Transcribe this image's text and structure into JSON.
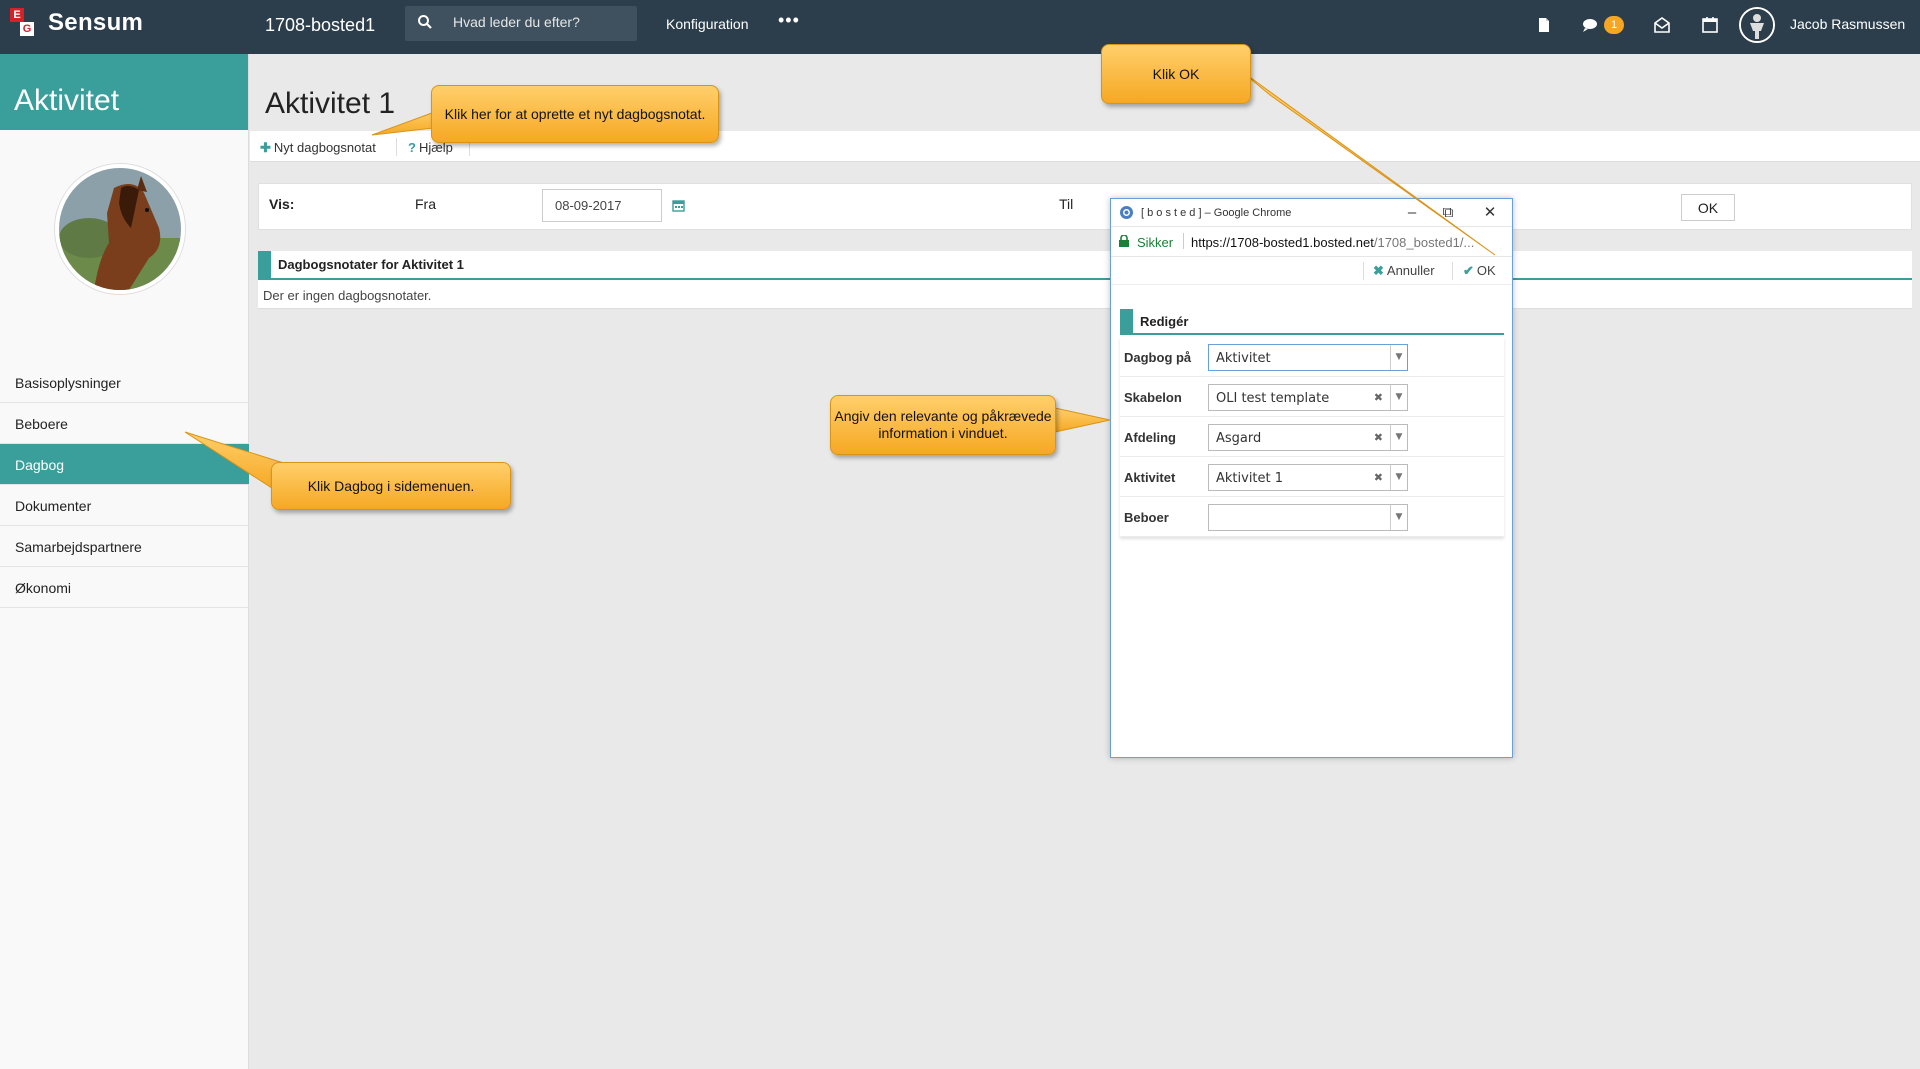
{
  "topbar": {
    "logo_text": "Sensum",
    "logo_letters": [
      "E",
      "G"
    ],
    "org_name": "1708-bosted1",
    "search_placeholder": "Hvad leder du efter?",
    "nav_config": "Konfiguration",
    "nav_more": "•••",
    "notification_count": "1",
    "user_name": "Jacob Rasmussen",
    "icons": [
      "search-icon",
      "document-icon",
      "chat-icon",
      "mail-icon",
      "calendar-icon",
      "user-avatar-icon"
    ]
  },
  "sidebar": {
    "title": "Aktivitet",
    "items": [
      {
        "label": "Basisoplysninger",
        "active": false
      },
      {
        "label": "Beboere",
        "active": false
      },
      {
        "label": "Dagbog",
        "active": true
      },
      {
        "label": "Dokumenter",
        "active": false
      },
      {
        "label": "Samarbejdspartnere",
        "active": false
      },
      {
        "label": "Økonomi",
        "active": false
      }
    ]
  },
  "main": {
    "page_title": "Aktivitet 1",
    "toolbar": {
      "new_note": "Nyt dagbogsnotat",
      "help": "Hjælp"
    },
    "filter": {
      "show_label": "Vis:",
      "from_label": "Fra",
      "from_value": "08-09-2017",
      "to_label": "Til",
      "ok_label": "OK"
    },
    "section_title": "Dagbogsnotater for Aktivitet 1",
    "empty_text": "Der er ingen dagbogsnotater."
  },
  "popup": {
    "window_title": "[ b o s t e d ] – Google Chrome",
    "secure_label": "Sikker",
    "url_host": "https://1708-bosted1.bosted.net",
    "url_path": "/1708_bosted1/...",
    "cancel_label": "Annuller",
    "ok_label": "OK",
    "edit_title": "Redigér",
    "fields": [
      {
        "label": "Dagbog på",
        "value": "Aktivitet",
        "clearable": false
      },
      {
        "label": "Skabelon",
        "value": "OLI test template",
        "clearable": true
      },
      {
        "label": "Afdeling",
        "value": "Asgard",
        "clearable": true
      },
      {
        "label": "Aktivitet",
        "value": "Aktivitet 1",
        "clearable": true
      },
      {
        "label": "Beboer",
        "value": "",
        "clearable": false
      }
    ]
  },
  "callouts": {
    "new_note": "Klik her for at oprette et nyt dagbogsnotat.",
    "ok": "Klik OK",
    "fill_info": "Angiv den relevante og påkrævede information i vinduet.",
    "dagbog": "Klik Dagbog i sidemenuen."
  },
  "colors": {
    "topbar": "#2c3e4b",
    "accent": "#3a9e9a",
    "callout": "#f6a823",
    "badge": "#f5a623"
  }
}
